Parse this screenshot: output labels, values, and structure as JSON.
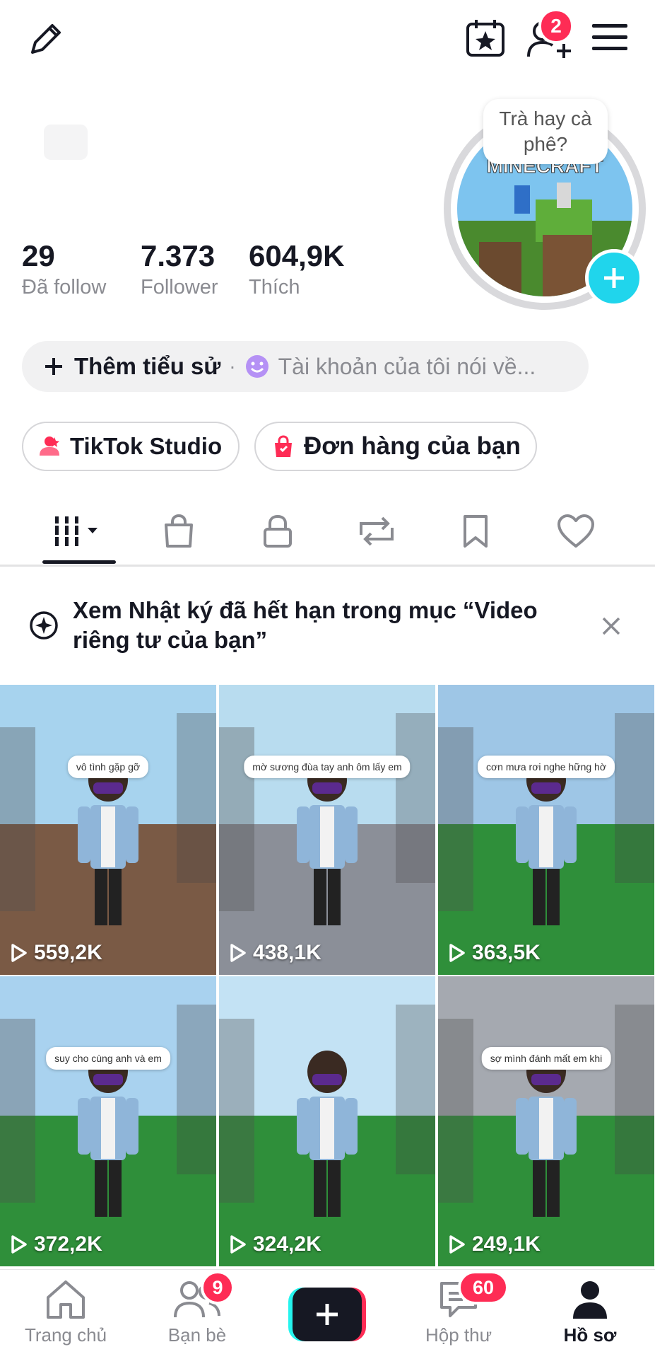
{
  "header": {
    "notif_badge": "2",
    "story_bubble": "Trà hay cà phê?",
    "avatar_text": "MINECRAFT"
  },
  "stats": [
    {
      "value": "29",
      "label": "Đã follow"
    },
    {
      "value": "7.373",
      "label": "Follower"
    },
    {
      "value": "604,9K",
      "label": "Thích"
    }
  ],
  "bio": {
    "add_label": "Thêm tiểu sử",
    "separator": "·",
    "placeholder": "Tài khoản của tôi nói về..."
  },
  "buttons": {
    "studio": "TikTok Studio",
    "orders": "Đơn hàng của bạn"
  },
  "tabs": [
    "videos",
    "shop",
    "private",
    "reposts",
    "saved",
    "liked"
  ],
  "banner": {
    "text": "Xem Nhật ký đã hết hạn trong mục “Video riêng tư của bạn”"
  },
  "videos": [
    {
      "views": "559,2K",
      "caption": "vô tình gặp gỡ",
      "sky": "#a7d3ee",
      "ground": "#7a5a45"
    },
    {
      "views": "438,1K",
      "caption": "mờ sương đùa tay anh ôm lấy em",
      "sky": "#b8dcef",
      "ground": "#8b8f98"
    },
    {
      "views": "363,5K",
      "caption": "cơn mưa rơi nghe hững hờ",
      "sky": "#9ec6e6",
      "ground": "#2f8f3a"
    },
    {
      "views": "372,2K",
      "caption": "suy cho cùng anh và em",
      "sky": "#a9d2ef",
      "ground": "#2f8f3a"
    },
    {
      "views": "324,2K",
      "caption": "",
      "sky": "#c3e2f4",
      "ground": "#2f8f3a"
    },
    {
      "views": "249,1K",
      "caption": "sợ mình đánh mất em khi",
      "sky": "#a5a9b0",
      "ground": "#2f8f3a"
    }
  ],
  "nav": {
    "home": "Trang chủ",
    "friends": "Bạn bè",
    "friends_badge": "9",
    "inbox": "Hộp thư",
    "inbox_badge": "60",
    "profile": "Hồ sơ"
  }
}
